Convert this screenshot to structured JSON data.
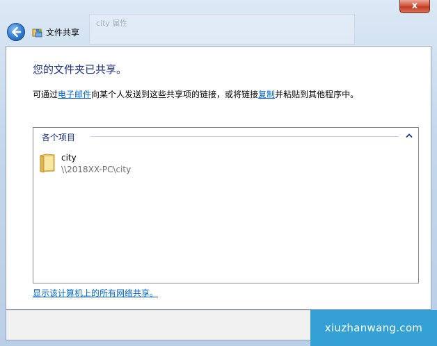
{
  "window": {
    "title": "文件共享",
    "background_window_title": "city 属性",
    "close_label": "x"
  },
  "main": {
    "heading": "您的文件夹已共享。",
    "desc_before": "可通过",
    "email_link": "电子邮件",
    "desc_middle": "向某个人发送到这些共享项的链接，或将链接",
    "copy_link": "复制",
    "desc_after": "并粘贴到其他程序中。",
    "group_label": "各个项目",
    "items": [
      {
        "name": "city",
        "path": "\\\\2018XX-PC\\city",
        "icon": "folder-icon"
      }
    ],
    "show_all_link": "显示该计算机上的所有网络共享。"
  },
  "watermark": "xiuzhanwang.com",
  "colors": {
    "heading": "#1e3287",
    "link": "#0066cc",
    "watermark_bg": "#34a1d6"
  }
}
